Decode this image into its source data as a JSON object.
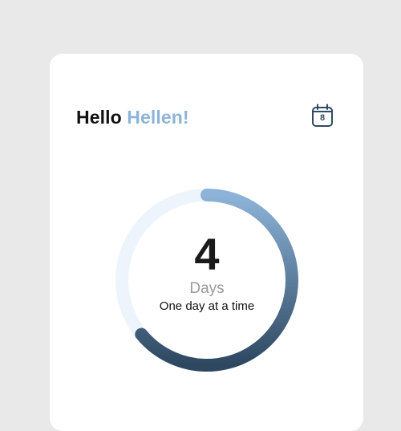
{
  "greeting": {
    "hello": "Hello",
    "name": "Hellen!"
  },
  "calendar": {
    "day": "8"
  },
  "progress": {
    "value": "4",
    "unit": "Days",
    "motto": "One day at a time",
    "fraction": 0.64,
    "colors": {
      "track": "#eef4fb",
      "start": "#8db4d8",
      "end": "#2d4760"
    }
  }
}
